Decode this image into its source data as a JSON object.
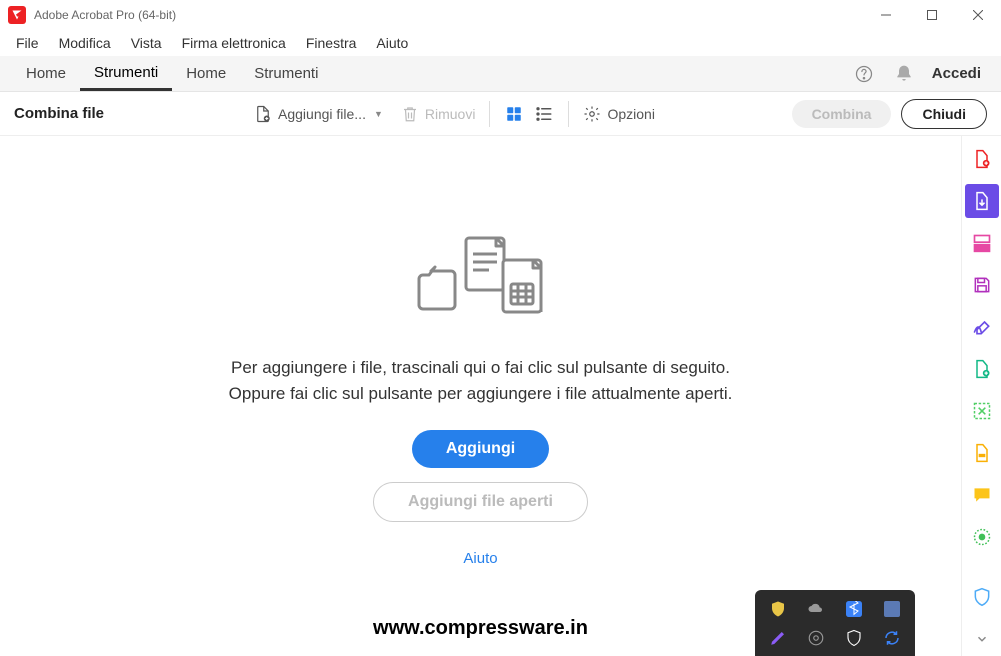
{
  "window": {
    "title": "Adobe Acrobat Pro (64-bit)"
  },
  "menu": {
    "items": [
      "File",
      "Modifica",
      "Vista",
      "Firma elettronica",
      "Finestra",
      "Aiuto"
    ]
  },
  "tabs": {
    "items": [
      "Home",
      "Strumenti",
      "Home",
      "Strumenti"
    ],
    "active_index": 1,
    "signin": "Accedi"
  },
  "toolbar": {
    "title": "Combina file",
    "add_files": "Aggiungi file...",
    "remove": "Rimuovi",
    "options": "Opzioni",
    "combine": "Combina",
    "close": "Chiudi"
  },
  "main": {
    "instruction_line1": "Per aggiungere i file, trascinali qui o fai clic sul pulsante di seguito.",
    "instruction_line2": "Oppure fai clic sul pulsante per aggiungere i file attualmente aperti.",
    "add_button": "Aggiungi",
    "add_open_button": "Aggiungi file aperti",
    "help_link": "Aiuto",
    "watermark": "www.compressware.in"
  },
  "rail": {
    "items": [
      {
        "name": "create-pdf-icon",
        "color": "#ed2224"
      },
      {
        "name": "export-pdf-icon",
        "color": "#ffffff",
        "active": true
      },
      {
        "name": "edit-pdf-icon",
        "color": "#e648a3"
      },
      {
        "name": "save-icon",
        "color": "#b130bd"
      },
      {
        "name": "sign-icon",
        "color": "#6b4ce6"
      },
      {
        "name": "organize-icon",
        "color": "#12b886"
      },
      {
        "name": "compress-icon",
        "color": "#51cf66"
      },
      {
        "name": "stamp-icon",
        "color": "#fab005"
      },
      {
        "name": "comment-icon",
        "color": "#fcc419"
      },
      {
        "name": "redact-icon",
        "color": "#40c057"
      }
    ],
    "protect": {
      "name": "protect-icon",
      "color": "#4dabf7"
    },
    "expand": {
      "name": "chevron-down-icon",
      "color": "#888"
    }
  }
}
